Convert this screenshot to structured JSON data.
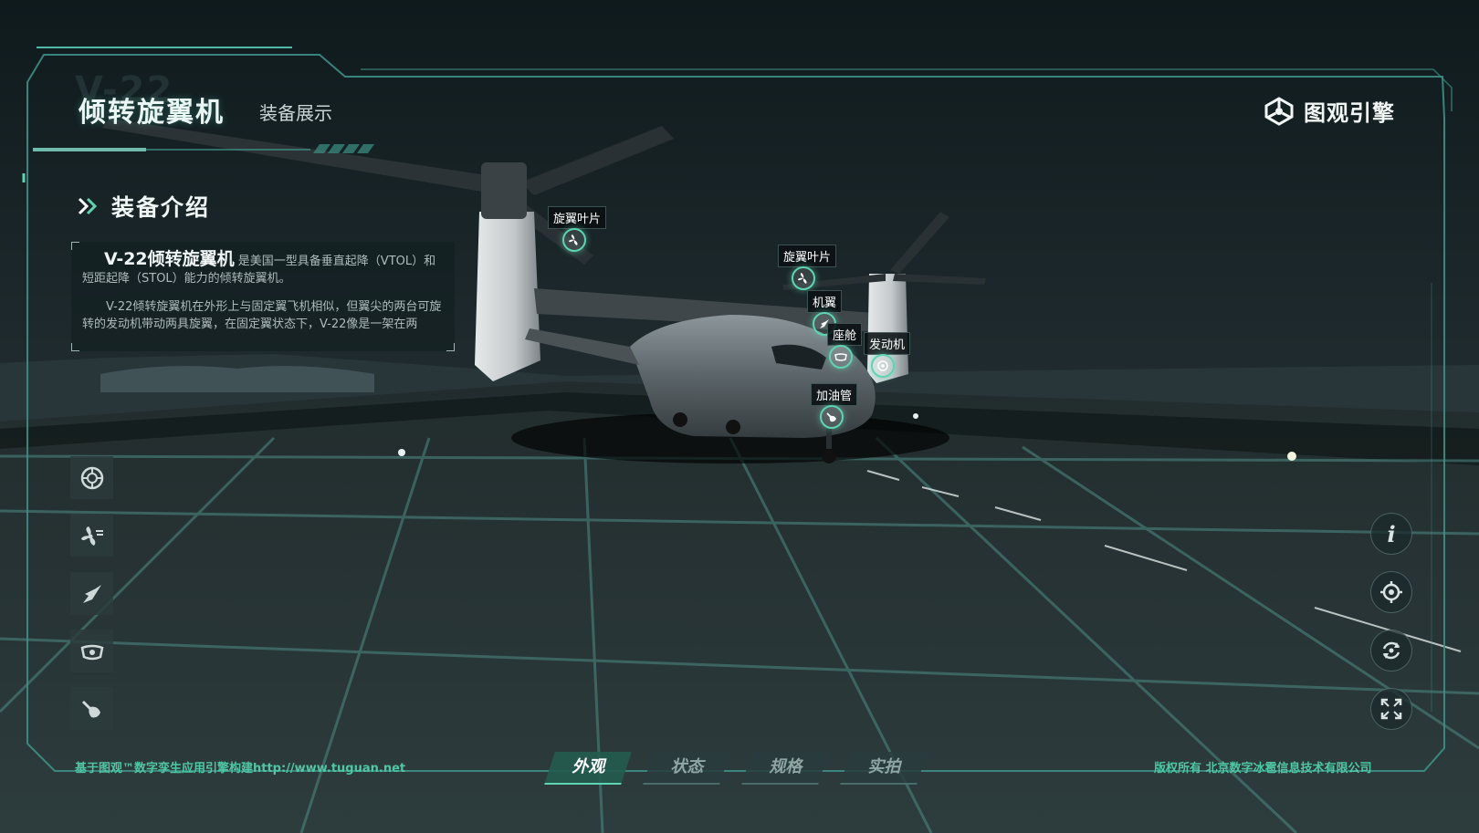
{
  "header": {
    "bg_code": "V-22",
    "title": "倾转旋翼机",
    "subtitle": "装备展示",
    "brand_name": "图观引擎"
  },
  "intro": {
    "section_title": "装备介绍",
    "lead_name": "V-22倾转旋翼机",
    "lead_rest": "是美国一型具备垂直起降（VTOL）和短距起降（STOL）能力的倾转旋翼机。",
    "para2": "V-22倾转旋翼机在外形上与固定翼飞机相似，但翼尖的两台可旋转的发动机带动两具旋翼，在固定翼状态下，V-22像是一架在两"
  },
  "left_tools": [
    {
      "name": "wheel-icon"
    },
    {
      "name": "rotor-icon"
    },
    {
      "name": "wing-icon"
    },
    {
      "name": "cockpit-icon"
    },
    {
      "name": "fuel-pipe-icon"
    }
  ],
  "right_tools": [
    {
      "name": "info-icon",
      "glyph": "i"
    },
    {
      "name": "locate-icon"
    },
    {
      "name": "rotate-icon"
    },
    {
      "name": "fullscreen-icon"
    }
  ],
  "hotspots": [
    {
      "label": "旋翼叶片",
      "icon": "rotor-icon"
    },
    {
      "label": "旋翼叶片",
      "icon": "rotor-icon"
    },
    {
      "label": "机翼",
      "icon": "wing-icon"
    },
    {
      "label": "座舱",
      "icon": "cockpit-icon"
    },
    {
      "label": "发动机",
      "icon": "engine-icon"
    },
    {
      "label": "加油管",
      "icon": "fuel-pipe-icon"
    }
  ],
  "tabs": [
    {
      "label": "外观",
      "active": true
    },
    {
      "label": "状态",
      "active": false
    },
    {
      "label": "规格",
      "active": false
    },
    {
      "label": "实拍",
      "active": false
    }
  ],
  "footer": {
    "left": "基于图观™数字孪生应用引擎构建http://www.tuguan.net",
    "right": "版权所有 北京数字冰雹信息技术有限公司"
  },
  "colors": {
    "accent": "#5fd4b2",
    "frame": "#3f8f86",
    "bg": "#1b2628"
  }
}
